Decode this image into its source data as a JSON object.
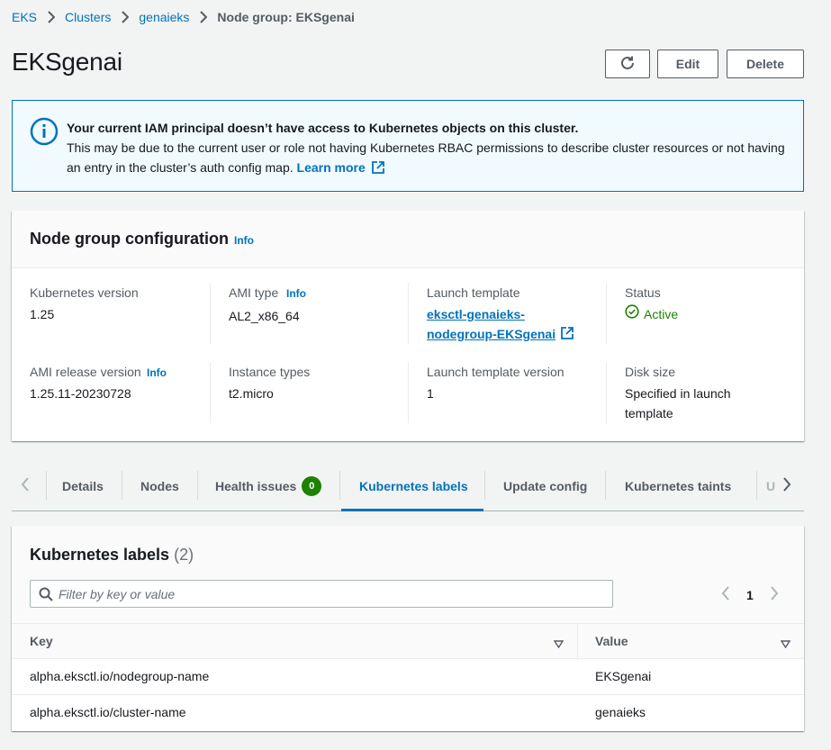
{
  "breadcrumb": {
    "items": [
      "EKS",
      "Clusters",
      "genaieks"
    ],
    "current": "Node group: EKSgenai"
  },
  "page": {
    "title": "EKSgenai"
  },
  "actions": {
    "refresh_icon": "refresh-icon",
    "edit_label": "Edit",
    "delete_label": "Delete"
  },
  "alert": {
    "icon": "info-circle-icon",
    "title": "Your current IAM principal doesn’t have access to Kubernetes objects on this cluster.",
    "body": "This may be due to the current user or role not having Kubernetes RBAC permissions to describe cluster resources or not having an entry in the cluster’s auth config map.",
    "learn_more": "Learn more"
  },
  "config": {
    "title": "Node group configuration",
    "info": "Info",
    "fields": {
      "k8s_version_label": "Kubernetes version",
      "k8s_version": "1.25",
      "ami_type_label": "AMI type",
      "ami_type_info": "Info",
      "ami_type": "AL2_x86_64",
      "launch_template_label": "Launch template",
      "launch_template_line1": "eksctl-genaieks-",
      "launch_template_line2": "nodegroup-EKSgenai",
      "status_label": "Status",
      "status": "Active",
      "ami_release_label": "AMI release version",
      "ami_release_info": "Info",
      "ami_release": "1.25.11-20230728",
      "instance_types_label": "Instance types",
      "instance_types": "t2.micro",
      "lt_version_label": "Launch template version",
      "lt_version": "1",
      "disk_size_label": "Disk size",
      "disk_size_line1": "Specified in launch",
      "disk_size_line2": "template"
    }
  },
  "tabs": {
    "items": [
      "Details",
      "Nodes",
      "Health issues",
      "Kubernetes labels",
      "Update config",
      "Kubernetes taints",
      "U"
    ],
    "health_badge": "0",
    "active": "Kubernetes labels"
  },
  "labels": {
    "title": "Kubernetes labels",
    "count": "(2)",
    "filter_placeholder": "Filter by key or value",
    "page": "1",
    "columns": [
      "Key",
      "Value"
    ],
    "rows": [
      {
        "key": "alpha.eksctl.io/nodegroup-name",
        "value": "EKSgenai"
      },
      {
        "key": "alpha.eksctl.io/cluster-name",
        "value": "genaieks"
      }
    ]
  },
  "colors": {
    "link": "#0073bb",
    "success": "#1d8102",
    "alert_bg": "#f1faff",
    "page_bg": "#f2f3f3"
  }
}
